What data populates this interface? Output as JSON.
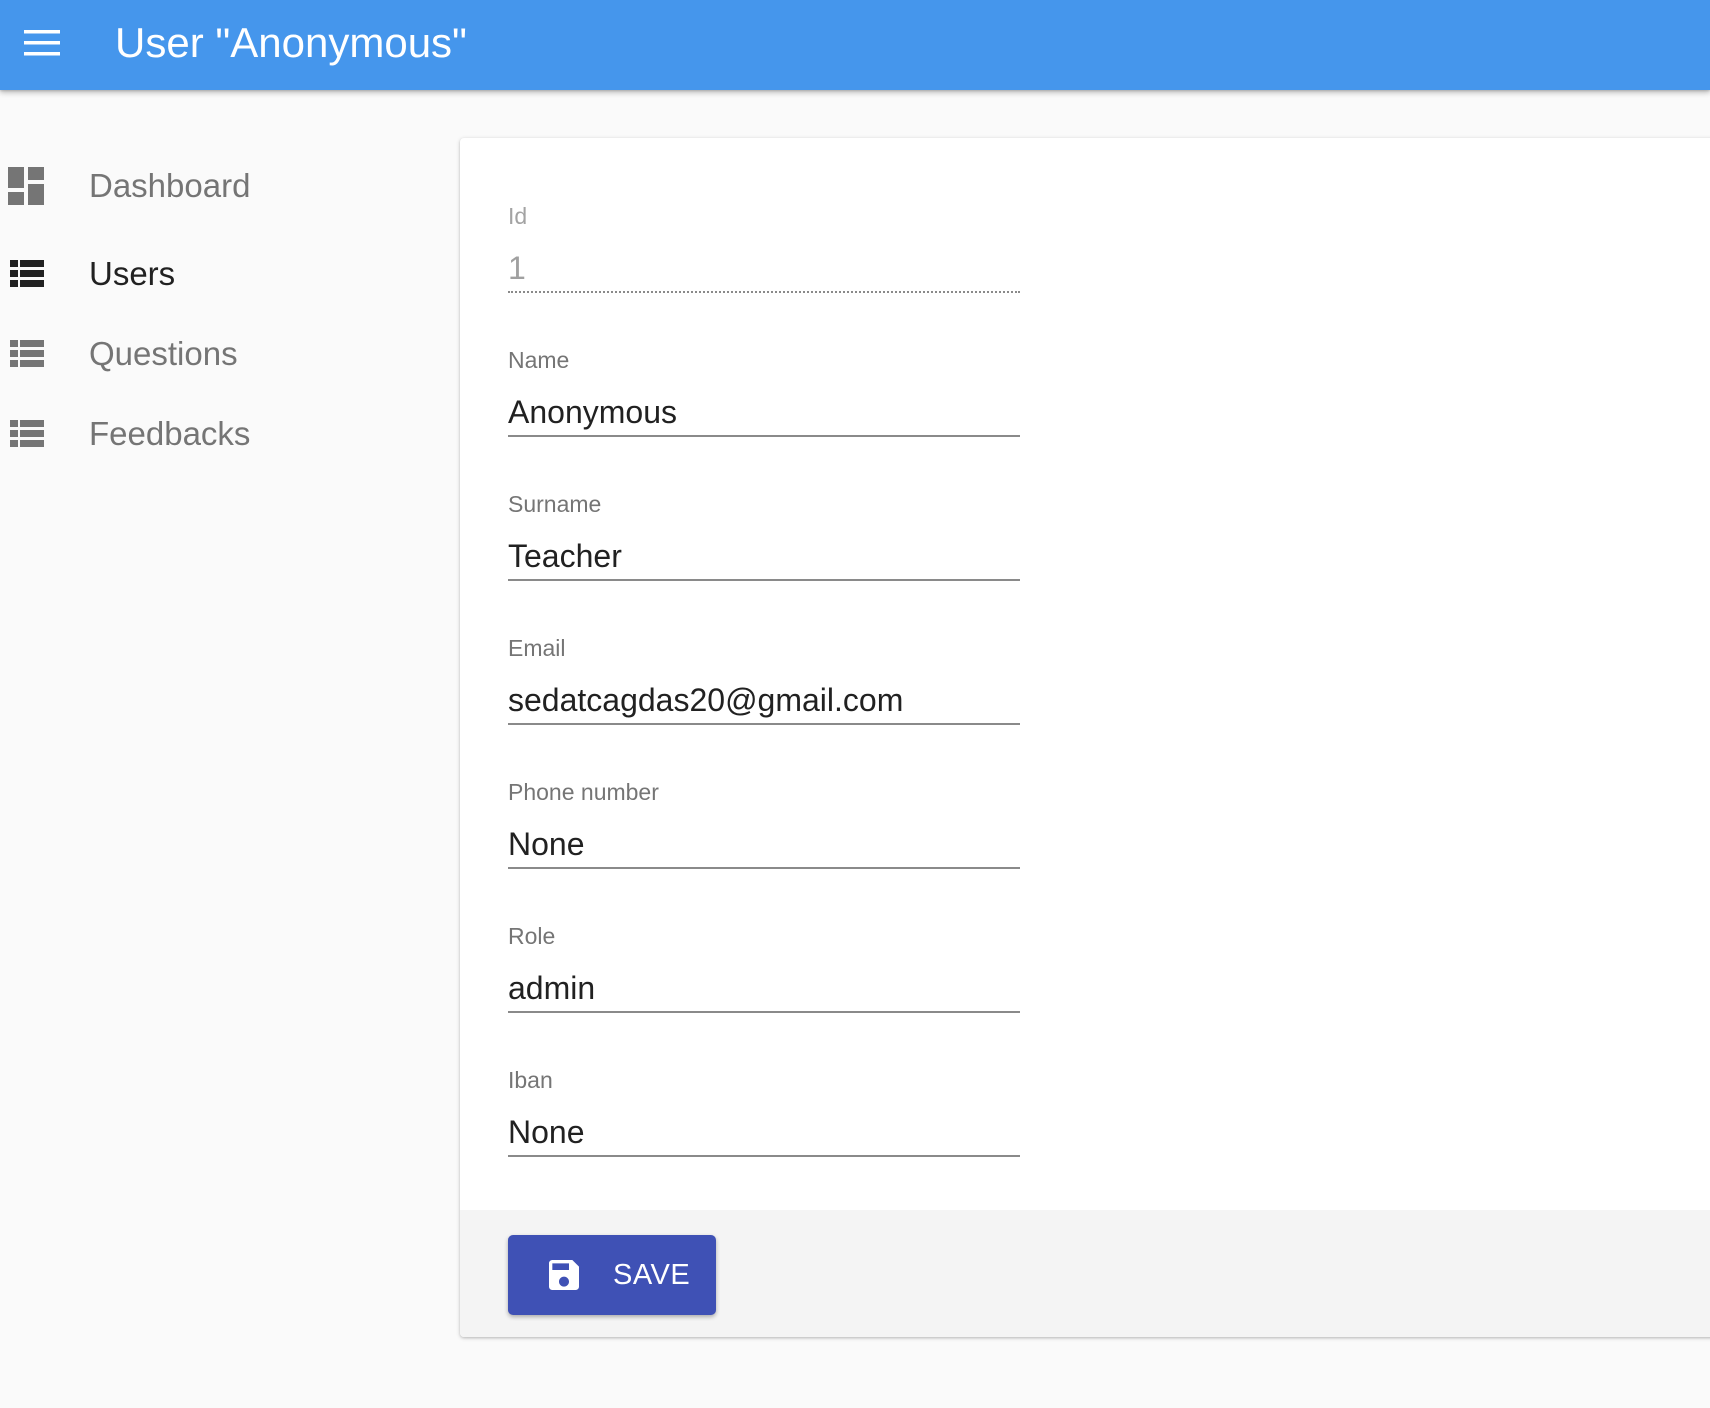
{
  "header": {
    "title": "User \"Anonymous\"",
    "menu_icon": "menu-icon",
    "background": "#4596ec"
  },
  "sidebar": {
    "items": [
      {
        "label": "Dashboard",
        "icon": "dashboard-icon",
        "active": false
      },
      {
        "label": "Users",
        "icon": "view-list-icon",
        "active": true
      },
      {
        "label": "Questions",
        "icon": "view-list-icon",
        "active": false
      },
      {
        "label": "Feedbacks",
        "icon": "view-list-icon",
        "active": false
      }
    ]
  },
  "form": {
    "fields": [
      {
        "label": "Id",
        "value": "1",
        "disabled": true
      },
      {
        "label": "Name",
        "value": "Anonymous"
      },
      {
        "label": "Surname",
        "value": "Teacher"
      },
      {
        "label": "Email",
        "value": "sedatcagdas20@gmail.com"
      },
      {
        "label": "Phone number",
        "value": "None"
      },
      {
        "label": "Role",
        "value": "admin"
      },
      {
        "label": "Iban",
        "value": "None"
      }
    ]
  },
  "toolbar": {
    "save_label": "SAVE",
    "save_icon": "save-icon",
    "save_color": "#3f51b5"
  }
}
